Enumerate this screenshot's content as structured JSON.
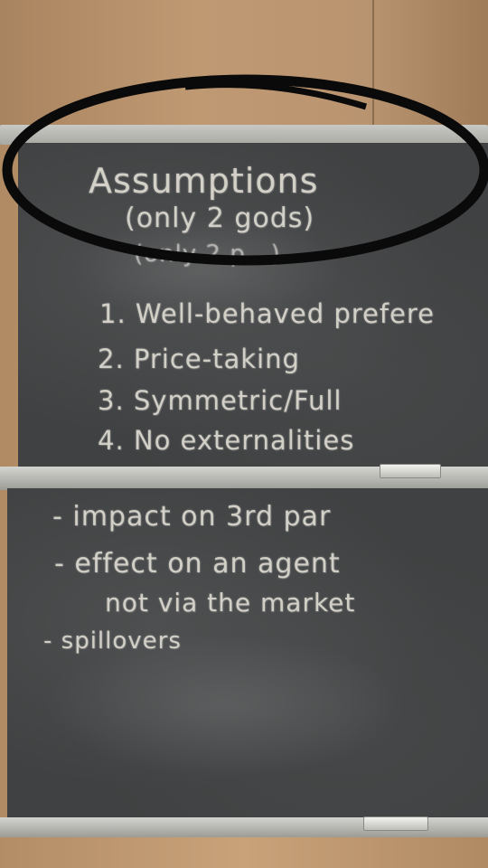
{
  "board_top": {
    "title": "Assumptions",
    "subtitle": "(only 2 gods)",
    "subtitle_faint": "(only 2 p...)",
    "items": [
      "1. Well-behaved prefere",
      "2. Price-taking",
      "3. Symmetric/Full",
      "4. No externalities"
    ]
  },
  "board_bottom": {
    "lines": [
      "- impact on 3rd par",
      "- effect on an agent",
      "not via the market",
      "- spillovers"
    ]
  },
  "colors": {
    "chalk": "#e4e0d6",
    "board": "#3f4142",
    "marker_oval": "#0a0a0a",
    "wall": "#b9946d"
  }
}
